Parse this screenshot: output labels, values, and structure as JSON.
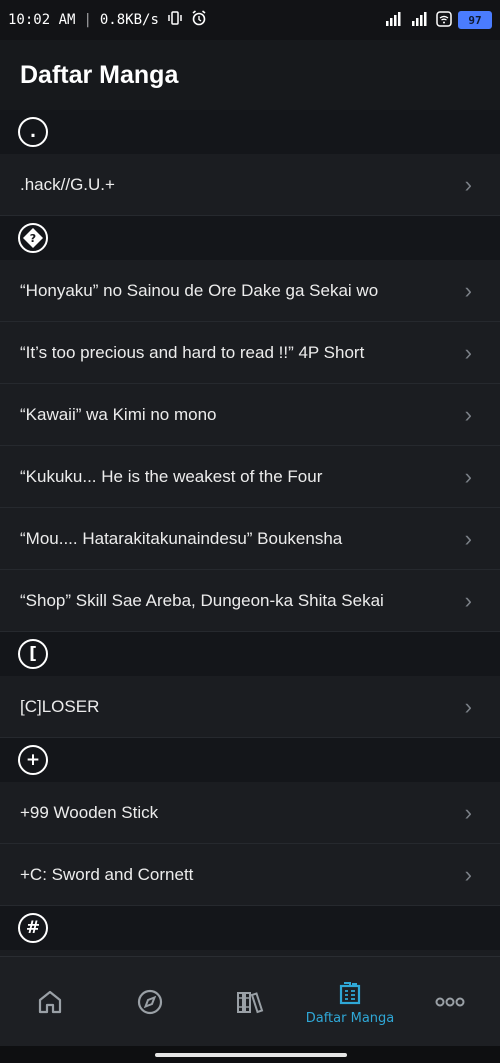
{
  "status": {
    "time": "10:02 AM",
    "speed": "0.8KB/s",
    "battery": "97"
  },
  "header": {
    "title": "Daftar Manga"
  },
  "sections": [
    {
      "badge": ".",
      "items": [
        ".hack//G.U.+"
      ]
    },
    {
      "badge": "?",
      "items": [
        "“Honyaku” no Sainou de Ore Dake ga Sekai wo",
        "“It’s too precious and hard to read !!” 4P Short",
        "“Kawaii” wa Kimi no mono",
        "“Kukuku... He is the weakest of the Four",
        "“Mou.... Hatarakitakunaindesu” Boukensha",
        "“Shop” Skill Sae Areba, Dungeon-ka Shita Sekai"
      ]
    },
    {
      "badge": "[",
      "items": [
        "[C]LOSER"
      ]
    },
    {
      "badge": "+",
      "items": [
        "+99 Wooden Stick",
        "+C: Sword and Cornett"
      ]
    },
    {
      "badge": "#",
      "items": []
    }
  ],
  "nav": {
    "items": [
      {
        "icon": "home-icon",
        "label": ""
      },
      {
        "icon": "compass-icon",
        "label": ""
      },
      {
        "icon": "library-icon",
        "label": ""
      },
      {
        "icon": "manga-list-icon",
        "label": "Daftar Manga",
        "active": true
      },
      {
        "icon": "more-icon",
        "label": ""
      }
    ]
  },
  "colors": {
    "accent": "#2fa7d6",
    "background": "#1b1d21",
    "section": "#14161a"
  }
}
